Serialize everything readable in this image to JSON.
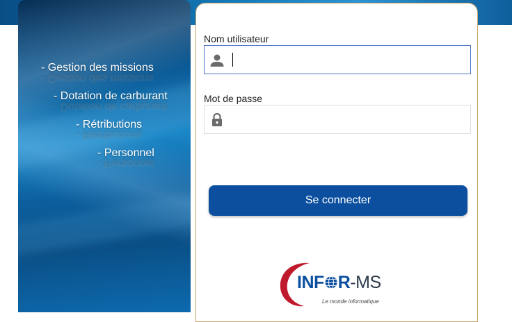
{
  "menu": {
    "items": [
      {
        "label": "- Gestion des missions"
      },
      {
        "label": "- Dotation de carburant"
      },
      {
        "label": "- Rétributions"
      },
      {
        "label": "- Personnel"
      }
    ]
  },
  "login": {
    "username": {
      "label": "Nom utilisateur",
      "value": "",
      "placeholder": "",
      "icon": "user-icon"
    },
    "password": {
      "label": "Mot de passe",
      "value": "",
      "placeholder": "",
      "icon": "lock-icon"
    },
    "submit_label": "Se connecter"
  },
  "logo": {
    "brand_left": "INF",
    "brand_mid": "R",
    "brand_suffix": "-MS",
    "tagline": "Le monde informatique"
  },
  "colors": {
    "primary": "#0b4f9e",
    "accent_red": "#c0192c",
    "card_border": "#c9a46a",
    "focus_border": "#4a72c4"
  }
}
